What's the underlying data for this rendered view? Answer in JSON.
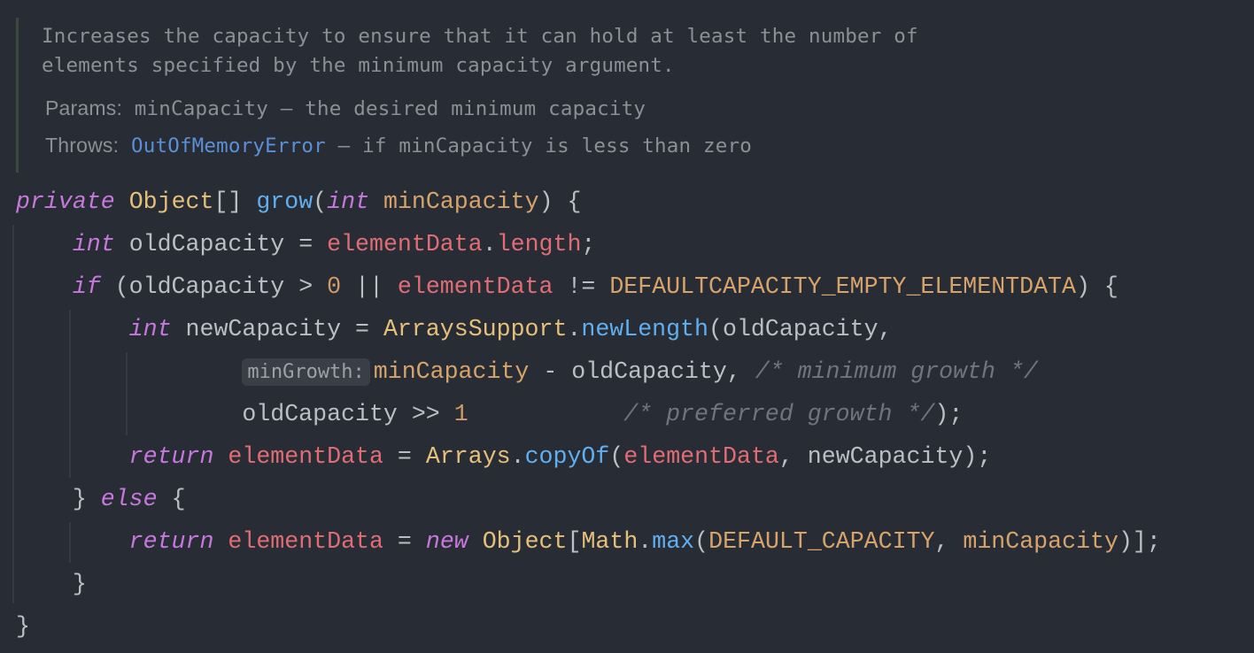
{
  "doc": {
    "description_lines": [
      "Increases the capacity to ensure that it can hold at least the number of",
      "elements specified by the minimum capacity argument."
    ],
    "params_label": "Params:",
    "params_text": "minCapacity – the desired minimum capacity",
    "throws_label": "Throws:",
    "throws_link": "OutOfMemoryError",
    "throws_text": " – if minCapacity is less than zero"
  },
  "code": {
    "lines": [
      [
        [
          "private",
          "kw"
        ],
        [
          " ",
          "txt"
        ],
        [
          "Object",
          "cls"
        ],
        [
          "[] ",
          "txt"
        ],
        [
          "grow",
          "fn"
        ],
        [
          "(",
          "txt"
        ],
        [
          "int",
          "kw"
        ],
        [
          " ",
          "txt"
        ],
        [
          "minCapacity",
          "par"
        ],
        [
          ") {",
          "txt"
        ]
      ],
      [
        [
          "    ",
          "txt"
        ],
        [
          "int",
          "kw"
        ],
        [
          " oldCapacity = ",
          "txt"
        ],
        [
          "elementData",
          "fld"
        ],
        [
          ".",
          "txt"
        ],
        [
          "length",
          "fld"
        ],
        [
          ";",
          "txt"
        ]
      ],
      [
        [
          "    ",
          "txt"
        ],
        [
          "if",
          "kw"
        ],
        [
          " (oldCapacity > ",
          "txt"
        ],
        [
          "0",
          "num"
        ],
        [
          " || ",
          "txt"
        ],
        [
          "elementData",
          "fld"
        ],
        [
          " != ",
          "txt"
        ],
        [
          "DEFAULTCAPACITY_EMPTY_ELEMENTDATA",
          "cst"
        ],
        [
          ") {",
          "txt"
        ]
      ],
      [
        [
          "        ",
          "txt"
        ],
        [
          "int",
          "kw"
        ],
        [
          " newCapacity = ",
          "txt"
        ],
        [
          "ArraysSupport",
          "cls"
        ],
        [
          ".",
          "txt"
        ],
        [
          "newLength",
          "fn"
        ],
        [
          "(oldCapacity,",
          "txt"
        ]
      ],
      [
        [
          "                ",
          "txt"
        ],
        [
          "minGrowth:",
          "hint"
        ],
        [
          "minCapacity",
          "par"
        ],
        [
          " - oldCapacity, ",
          "txt"
        ],
        [
          "/* minimum growth */",
          "cmt"
        ]
      ],
      [
        [
          "                ",
          "txt"
        ],
        [
          "oldCapacity >> ",
          "txt"
        ],
        [
          "1",
          "num"
        ],
        [
          "           ",
          "txt"
        ],
        [
          "/* preferred growth */",
          "cmt"
        ],
        [
          ");",
          "txt"
        ]
      ],
      [
        [
          "        ",
          "txt"
        ],
        [
          "return",
          "kw"
        ],
        [
          " ",
          "txt"
        ],
        [
          "elementData",
          "fld"
        ],
        [
          " = ",
          "txt"
        ],
        [
          "Arrays",
          "cls"
        ],
        [
          ".",
          "txt"
        ],
        [
          "copyOf",
          "fn"
        ],
        [
          "(",
          "txt"
        ],
        [
          "elementData",
          "fld"
        ],
        [
          ", newCapacity);",
          "txt"
        ]
      ],
      [
        [
          "    } ",
          "txt"
        ],
        [
          "else",
          "kw"
        ],
        [
          " {",
          "txt"
        ]
      ],
      [
        [
          "        ",
          "txt"
        ],
        [
          "return",
          "kw"
        ],
        [
          " ",
          "txt"
        ],
        [
          "elementData",
          "fld"
        ],
        [
          " = ",
          "txt"
        ],
        [
          "new",
          "kw"
        ],
        [
          " ",
          "txt"
        ],
        [
          "Object",
          "cls"
        ],
        [
          "[",
          "txt"
        ],
        [
          "Math",
          "cls"
        ],
        [
          ".",
          "txt"
        ],
        [
          "max",
          "fn"
        ],
        [
          "(",
          "txt"
        ],
        [
          "DEFAULT_CAPACITY",
          "cst"
        ],
        [
          ", ",
          "txt"
        ],
        [
          "minCapacity",
          "par"
        ],
        [
          ")];",
          "txt"
        ]
      ],
      [
        [
          "    }",
          "txt"
        ]
      ],
      [
        [
          "}",
          "txt"
        ]
      ]
    ]
  }
}
